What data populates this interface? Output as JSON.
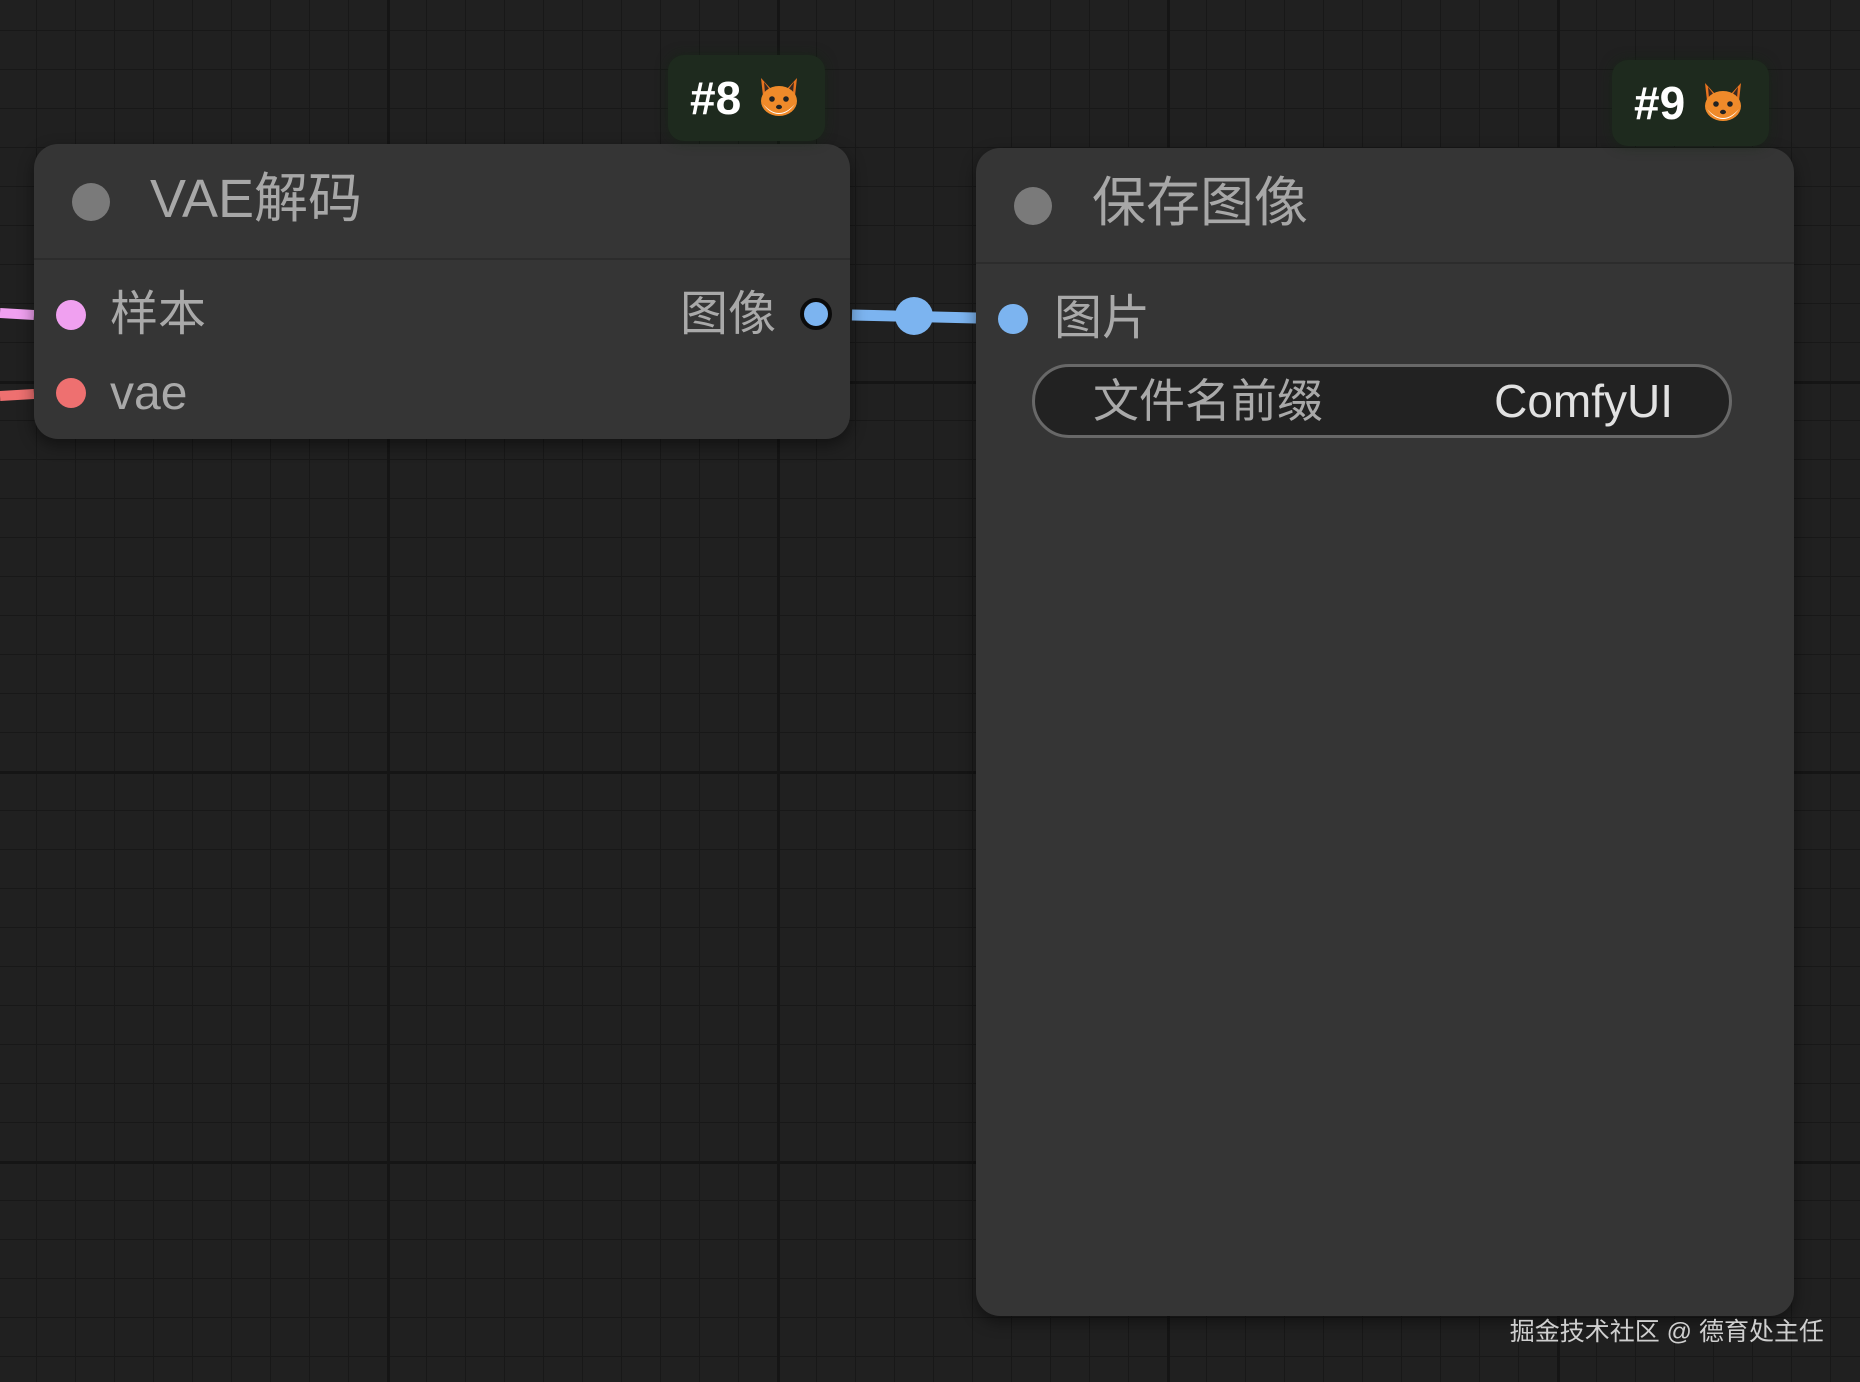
{
  "node_8": {
    "badge_id": "#8",
    "badge_icon": "fox-icon",
    "title": "VAE解码",
    "inputs": [
      {
        "label": "样本",
        "color": "#f0a0f0"
      },
      {
        "label": "vae",
        "color": "#ee7070"
      }
    ],
    "outputs": [
      {
        "label": "图像",
        "color": "#7cb4f0"
      }
    ]
  },
  "node_9": {
    "badge_id": "#9",
    "badge_icon": "fox-icon",
    "title": "保存图像",
    "inputs": [
      {
        "label": "图片",
        "color": "#7cb4f0"
      }
    ],
    "widget": {
      "label": "文件名前缀",
      "value": "ComfyUI"
    }
  },
  "watermark": "掘金技术社区 @ 德育处主任"
}
